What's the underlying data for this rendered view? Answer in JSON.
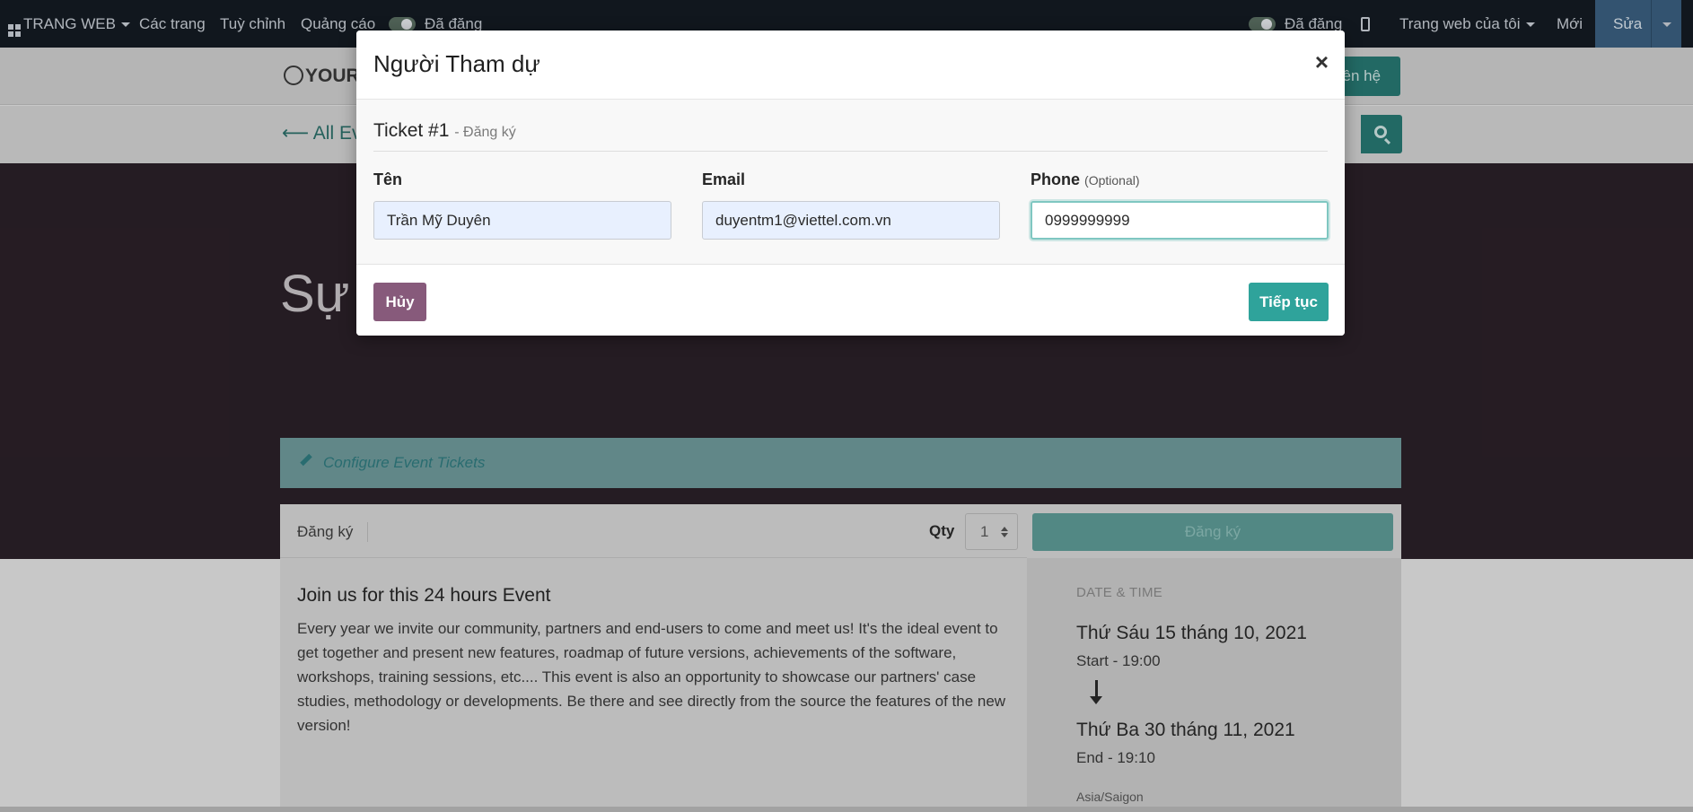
{
  "topbar": {
    "menu_label": "TRANG WEB",
    "pages": "Các trang",
    "customize": "Tuỳ chỉnh",
    "promote": "Quảng cáo",
    "published_left": "Đã đăng",
    "published_right": "Đã đăng",
    "my_website": "Trang web của tôi",
    "new": "Mới",
    "edit": "Sửa"
  },
  "header": {
    "logo_text": "YOUR",
    "contact_label": "liên hệ",
    "back_link": "All Ev",
    "hero_title": "Sự"
  },
  "configure_tickets": "Configure Event Tickets",
  "registration": {
    "label": "Đăng ký",
    "qty_label": "Qty",
    "qty_value": "1",
    "submit_label": "Đăng ký"
  },
  "description": {
    "title": "Join us for this 24 hours Event",
    "body": "Every year we invite our community, partners and end-users to come and meet us! It's the ideal event to get together and present new features, roadmap of future versions, achievements of the software, workshops, training sessions, etc.... This event is also an opportunity to showcase our partners' case studies, methodology or developments. Be there and see directly from the source the features of the new version!"
  },
  "date_time": {
    "label": "DATE & TIME",
    "start_date": "Thứ Sáu 15 tháng 10, 2021",
    "start_time": "Start - 19:00",
    "end_date": "Thứ Ba 30 tháng 11, 2021",
    "end_time": "End - 19:10",
    "timezone": "Asia/Saigon"
  },
  "modal": {
    "title": "Người Tham dự",
    "close_symbol": "×",
    "ticket_title": "Ticket #1",
    "ticket_subtitle": "- Đăng ký",
    "fields": {
      "name_label": "Tên",
      "name_value": "Trần Mỹ Duyên",
      "email_label": "Email",
      "email_value": "duyentm1@viettel.com.vn",
      "phone_label": "Phone",
      "phone_optional": "(Optional)",
      "phone_value": "0999999999"
    },
    "cancel_label": "Hủy",
    "continue_label": "Tiếp tục"
  },
  "colors": {
    "topbar_bg": "#141b23",
    "primary_teal": "#2fa39b",
    "cancel_purple": "#875a7b",
    "hero_bg": "#2b2028"
  }
}
